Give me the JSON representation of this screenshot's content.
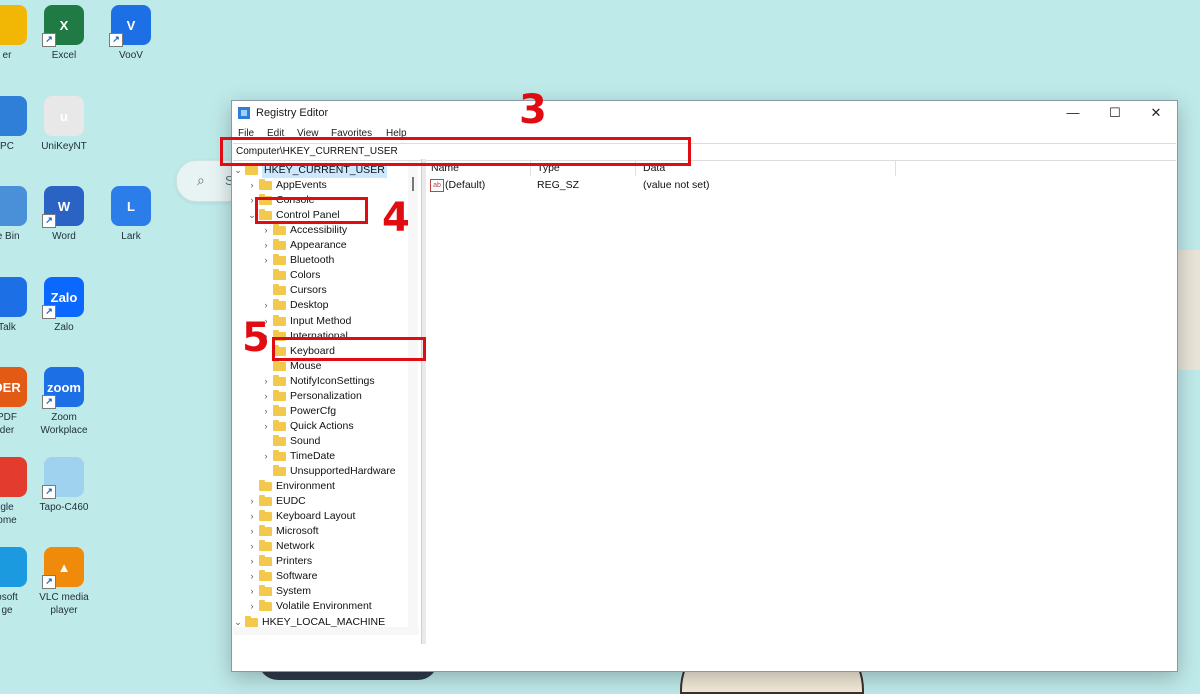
{
  "desktop": {
    "icons": [
      {
        "label": "er",
        "color": "#f2b705",
        "glyph": ""
      },
      {
        "label": "Excel",
        "color": "#1f7a44",
        "glyph": "X"
      },
      {
        "label": "VooV",
        "color": "#1d6fe5",
        "glyph": "V"
      },
      {
        "label": "PC",
        "color": "#2f7ed8",
        "glyph": ""
      },
      {
        "label": "UniKeyNT",
        "color": "#e8e8e8",
        "glyph": "u"
      },
      {
        "label": "le Bin",
        "color": "#4a90d9",
        "glyph": ""
      },
      {
        "label": "Word",
        "color": "#2b63c4",
        "glyph": "W"
      },
      {
        "label": "Lark",
        "color": "#2b7de9",
        "glyph": "L"
      },
      {
        "label": "Talk",
        "color": "#1d6fe5",
        "glyph": ""
      },
      {
        "label": "Zalo",
        "color": "#0a68ff",
        "glyph": "Zalo"
      },
      {
        "label": "PDF",
        "label2": "der",
        "color": "#e35a14",
        "glyph": "DER"
      },
      {
        "label": "Zoom",
        "label2": "Workplace",
        "color": "#1d6fe5",
        "glyph": "zoom"
      },
      {
        "label": "gle",
        "label2": "ome",
        "color": "#e33b2e",
        "glyph": ""
      },
      {
        "label": "Tapo-C460",
        "color": "#9fd2ef",
        "glyph": ""
      },
      {
        "label": "osoft",
        "label2": "ge",
        "color": "#1c9ae0",
        "glyph": ""
      },
      {
        "label": "VLC media",
        "label2": "player",
        "color": "#f08a0a",
        "glyph": "▲"
      }
    ],
    "search_letter": "S"
  },
  "window": {
    "title": "Registry Editor",
    "controls": {
      "minimize": "—",
      "maximize": "☐",
      "close": "✕"
    },
    "menu": [
      "File",
      "Edit",
      "View",
      "Favorites",
      "Help"
    ],
    "address": "Computer\\HKEY_CURRENT_USER",
    "tree": [
      {
        "label": "HKEY_CURRENT_USER",
        "chev": "⌄",
        "indent": 0,
        "selected": true
      },
      {
        "label": "AppEvents",
        "chev": "›",
        "indent": 1
      },
      {
        "label": "Console",
        "chev": "›",
        "indent": 1
      },
      {
        "label": "Control Panel",
        "chev": "⌄",
        "indent": 1
      },
      {
        "label": "Accessibility",
        "chev": "›",
        "indent": 2
      },
      {
        "label": "Appearance",
        "chev": "›",
        "indent": 2
      },
      {
        "label": "Bluetooth",
        "chev": "›",
        "indent": 2
      },
      {
        "label": "Colors",
        "chev": "",
        "indent": 2
      },
      {
        "label": "Cursors",
        "chev": "",
        "indent": 2
      },
      {
        "label": "Desktop",
        "chev": "›",
        "indent": 2
      },
      {
        "label": "Input Method",
        "chev": "›",
        "indent": 2
      },
      {
        "label": "International",
        "chev": "›",
        "indent": 2
      },
      {
        "label": "Keyboard",
        "chev": "",
        "indent": 2
      },
      {
        "label": "Mouse",
        "chev": "",
        "indent": 2
      },
      {
        "label": "NotifyIconSettings",
        "chev": "›",
        "indent": 2
      },
      {
        "label": "Personalization",
        "chev": "›",
        "indent": 2
      },
      {
        "label": "PowerCfg",
        "chev": "›",
        "indent": 2
      },
      {
        "label": "Quick Actions",
        "chev": "›",
        "indent": 2
      },
      {
        "label": "Sound",
        "chev": "",
        "indent": 2
      },
      {
        "label": "TimeDate",
        "chev": "›",
        "indent": 2
      },
      {
        "label": "UnsupportedHardware",
        "chev": "",
        "indent": 2
      },
      {
        "label": "Environment",
        "chev": "",
        "indent": 1
      },
      {
        "label": "EUDC",
        "chev": "›",
        "indent": 1
      },
      {
        "label": "Keyboard Layout",
        "chev": "›",
        "indent": 1
      },
      {
        "label": "Microsoft",
        "chev": "›",
        "indent": 1
      },
      {
        "label": "Network",
        "chev": "›",
        "indent": 1
      },
      {
        "label": "Printers",
        "chev": "›",
        "indent": 1
      },
      {
        "label": "Software",
        "chev": "›",
        "indent": 1
      },
      {
        "label": "System",
        "chev": "›",
        "indent": 1
      },
      {
        "label": "Volatile Environment",
        "chev": "›",
        "indent": 1
      },
      {
        "label": "HKEY_LOCAL_MACHINE",
        "chev": "⌄",
        "indent": 0
      }
    ],
    "columns": {
      "name": "Name",
      "type": "Type",
      "data": "Data"
    },
    "values": [
      {
        "icon": "ab",
        "name": "(Default)",
        "type": "REG_SZ",
        "data": "(value not set)"
      }
    ]
  },
  "annotations": {
    "color": "#e10b12",
    "steps": [
      "3",
      "4",
      "5"
    ]
  }
}
